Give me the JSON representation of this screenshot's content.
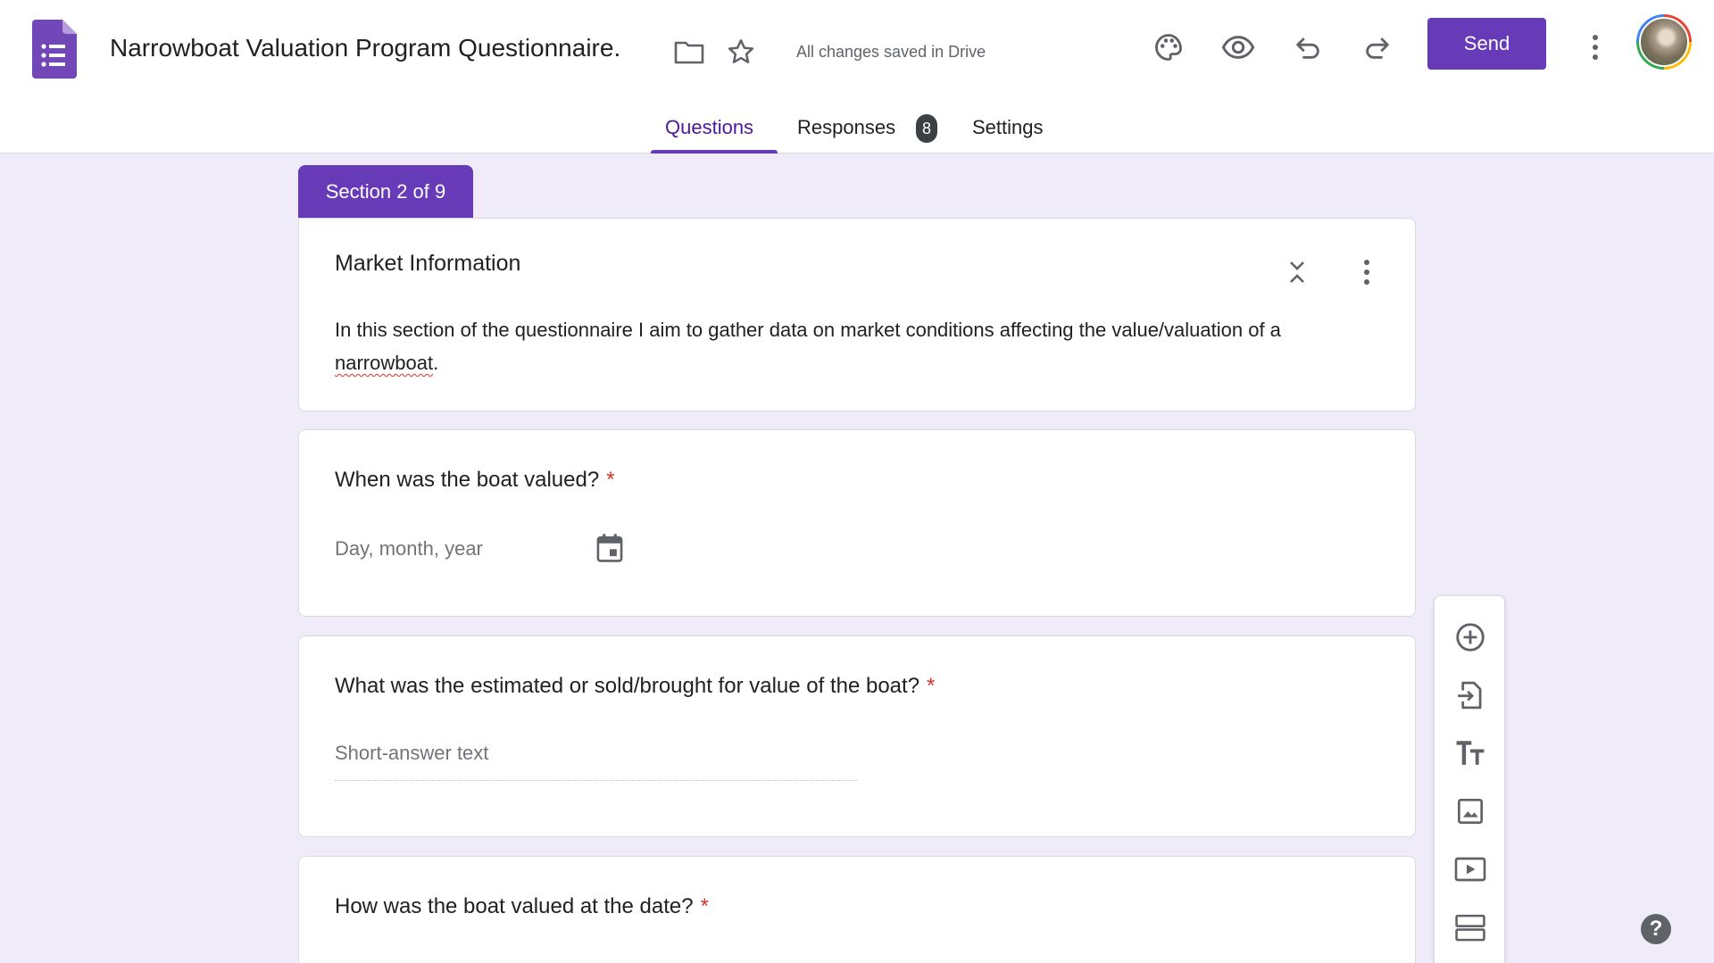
{
  "app": {
    "doc_title": "Narrowboat Valuation Program Questionnaire.",
    "save_status": "All changes saved in Drive",
    "send_label": "Send",
    "icons": [
      "forms-logo-icon",
      "folder-icon",
      "star-icon",
      "palette-icon",
      "eye-icon",
      "undo-icon",
      "redo-icon",
      "more-vert-icon",
      "avatar"
    ]
  },
  "tabs": {
    "questions": "Questions",
    "responses": "Responses",
    "responses_count": "8",
    "settings": "Settings"
  },
  "section": {
    "tab_label": "Section 2 of 9",
    "title": "Market Information",
    "description_part1": "In this section of the questionnaire I aim to gather data on market conditions affecting the value/valuation of a ",
    "description_misspelled": "narrowboat",
    "description_part2": "."
  },
  "questions": [
    {
      "title": "When was the boat valued?",
      "required_mark": "*",
      "placeholder": "Day, month, year"
    },
    {
      "title": "What was the estimated or sold/brought for value of the boat?",
      "required_mark": "*",
      "placeholder": "Short-answer text"
    },
    {
      "title": "How was the boat valued at the date?",
      "required_mark": "*"
    }
  ],
  "toolbar": {
    "items": [
      "add-question-icon",
      "import-questions-icon",
      "add-title-icon",
      "add-image-icon",
      "add-video-icon",
      "add-section-icon"
    ]
  },
  "help": {
    "label": "?"
  },
  "colors": {
    "accent": "#673ab7",
    "background": "#efebf8",
    "required": "#d93025"
  }
}
